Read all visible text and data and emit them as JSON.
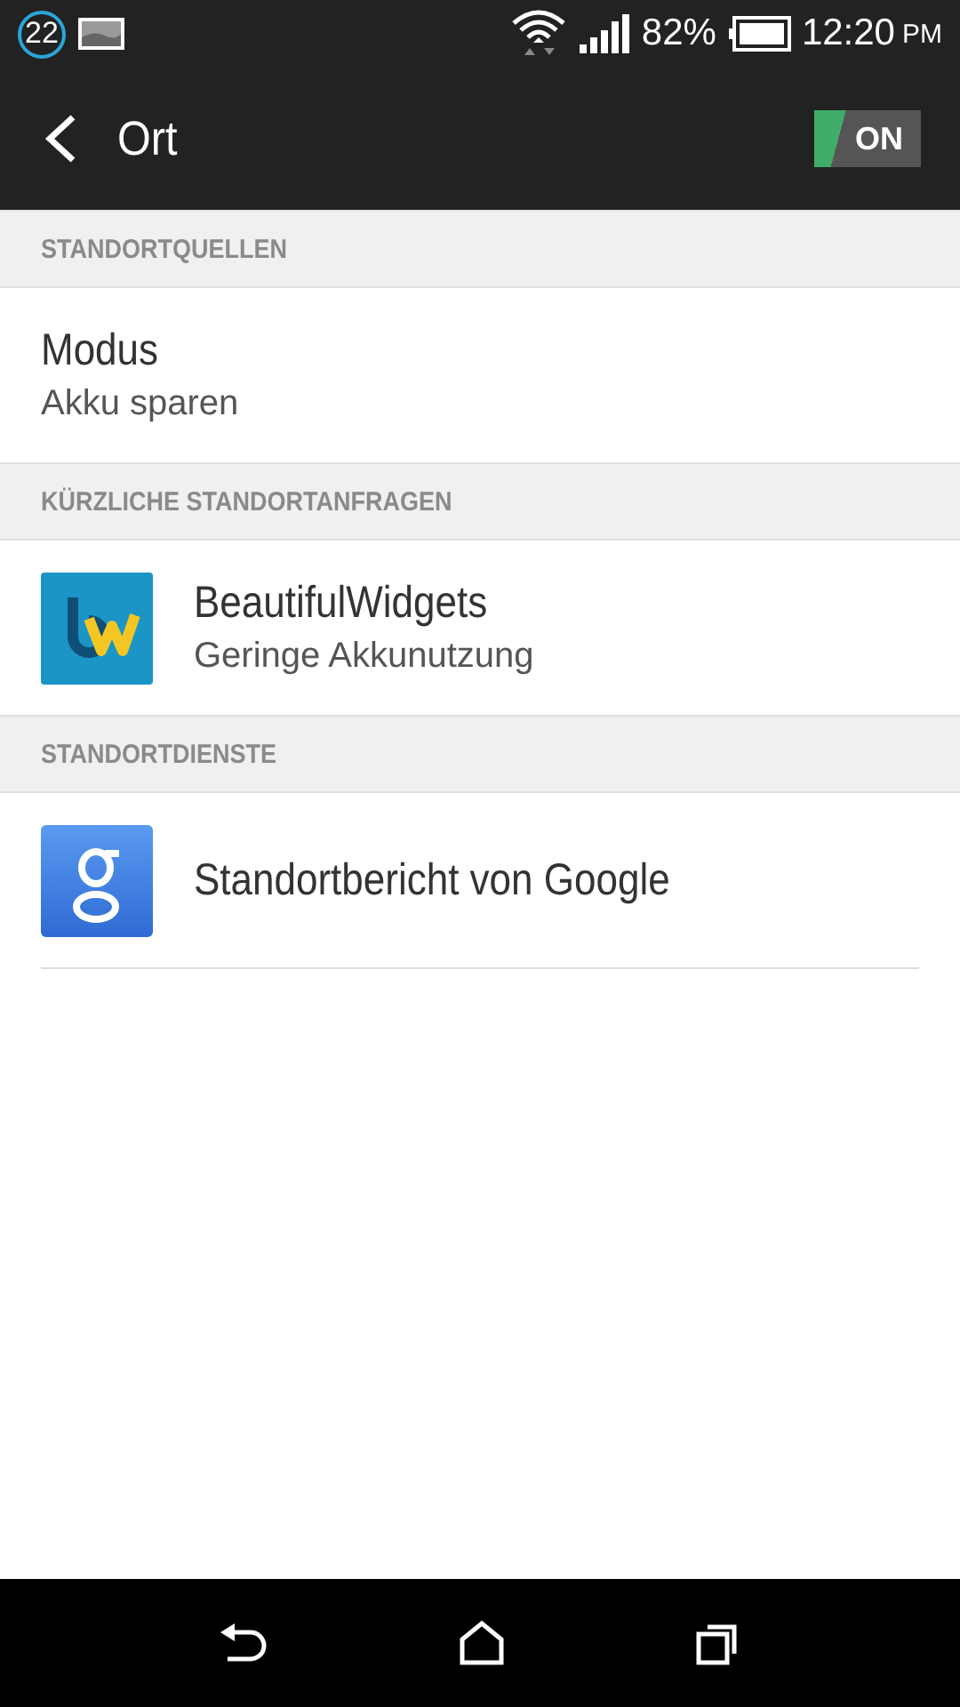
{
  "status_bar": {
    "notification_count": "22",
    "battery": "82%",
    "time": "12:20",
    "ampm": "PM"
  },
  "app_bar": {
    "title": "Ort",
    "toggle": {
      "label": "ON",
      "on": true
    }
  },
  "sections": [
    {
      "header": "STANDORTQUELLEN",
      "items": [
        {
          "kind": "text",
          "title": "Modus",
          "subtitle": "Akku sparen"
        }
      ]
    },
    {
      "header": "KÜRZLICHE STANDORTANFRAGEN",
      "items": [
        {
          "kind": "app-bw",
          "title": "BeautifulWidgets",
          "subtitle": "Geringe Akkunutzung"
        }
      ]
    },
    {
      "header": "STANDORTDIENSTE",
      "items": [
        {
          "kind": "app-google",
          "title": "Standortbericht von Google"
        }
      ]
    }
  ]
}
